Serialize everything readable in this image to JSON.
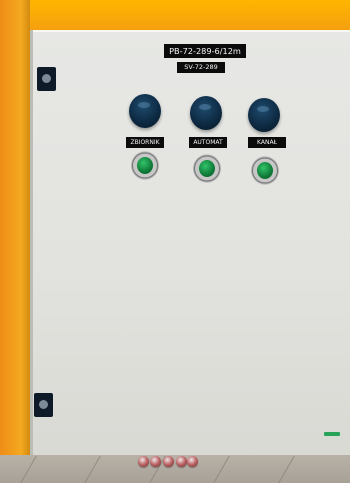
{
  "panel": {
    "title": "PB-72-289-6/12m",
    "subtitle": "SV-72-289",
    "labels": [
      "ZBIORNIK",
      "AUTOMAT",
      "KANAŁ"
    ]
  },
  "colors": {
    "background": "#f2a81d",
    "cabinet": "#e4e4e1",
    "knob": "#0e2b44",
    "button": "#1fa255",
    "plate": "#0b0b0b"
  },
  "icons": {
    "door_lock": "lock-icon"
  }
}
